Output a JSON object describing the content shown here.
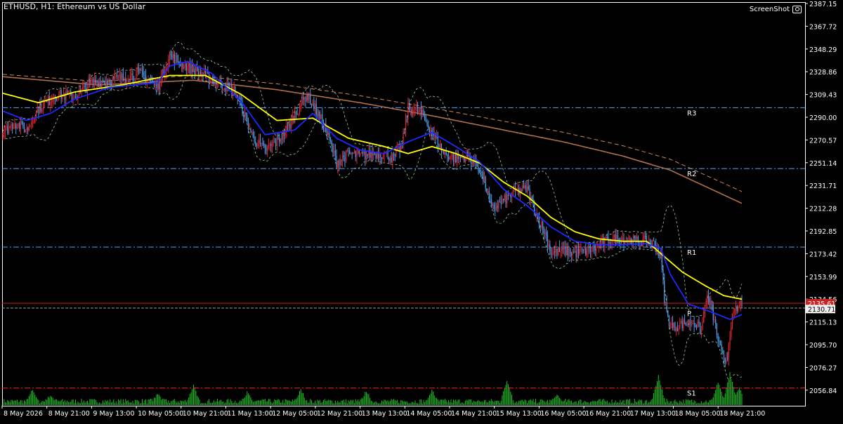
{
  "header": {
    "symbol_line": "ETHUSD, H1:  Ethereum vs US Dollar"
  },
  "watermark": {
    "label": "ScreenShot"
  },
  "colors": {
    "bg": "#000000",
    "bull": "#e0252f",
    "bear": "#4f9be8",
    "yellow_ma": "#ffff00",
    "blue_ma": "#1a2bff",
    "brown_ma": "#b0704a",
    "band": "#9ecf9e",
    "pivot": "#4aa6ff",
    "s1": "#ff2020",
    "volume": "#22c02a",
    "bid": "#cc2222"
  },
  "chart_data": {
    "type": "candlestick",
    "ylim": [
      2049,
      2390
    ],
    "price_ticks": [
      "2387.15",
      "2367.72",
      "2348.29",
      "2328.86",
      "2309.43",
      "2290.00",
      "2270.57",
      "2251.14",
      "2231.71",
      "2212.28",
      "2192.85",
      "2173.42",
      "2153.99",
      "2134.56",
      "2115.13",
      "2095.70",
      "2076.27",
      "2056.84"
    ],
    "time_labels": [
      "8 May 2026",
      "8 May 21:00",
      "9 May 13:00",
      "10 May 05:00",
      "10 May 21:00",
      "11 May 13:00",
      "12 May 05:00",
      "12 May 21:00",
      "13 May 13:00",
      "14 May 05:00",
      "14 May 21:00",
      "15 May 13:00",
      "16 May 05:00",
      "16 May 21:00",
      "17 May 13:00",
      "18 May 05:00",
      "18 May 21:00"
    ],
    "pivot_levels": [
      {
        "name": "R3",
        "value": 2300.8
      },
      {
        "name": "R2",
        "value": 2249.4
      },
      {
        "name": "R1",
        "value": 2183.0
      },
      {
        "name": "P",
        "value": 2131.5
      },
      {
        "name": "S1",
        "value": 2064.0
      }
    ],
    "current_price": {
      "label": "2135.61",
      "value": 2135.61
    },
    "ask_price": {
      "label": "2130.71",
      "value": 2130.71
    },
    "close_series_keypoints": [
      [
        0,
        2280
      ],
      [
        10,
        2288
      ],
      [
        20,
        2282
      ],
      [
        30,
        2300
      ],
      [
        45,
        2312
      ],
      [
        60,
        2310
      ],
      [
        75,
        2322
      ],
      [
        90,
        2324
      ],
      [
        100,
        2326
      ],
      [
        115,
        2330
      ],
      [
        130,
        2318
      ],
      [
        140,
        2345
      ],
      [
        150,
        2338
      ],
      [
        165,
        2330
      ],
      [
        180,
        2322
      ],
      [
        195,
        2315
      ],
      [
        210,
        2275
      ],
      [
        220,
        2265
      ],
      [
        230,
        2272
      ],
      [
        240,
        2285
      ],
      [
        245,
        2295
      ],
      [
        255,
        2312
      ],
      [
        262,
        2300
      ],
      [
        270,
        2285
      ],
      [
        280,
        2255
      ],
      [
        290,
        2262
      ],
      [
        300,
        2260
      ],
      [
        310,
        2262
      ],
      [
        320,
        2262
      ],
      [
        328,
        2258
      ],
      [
        335,
        2270
      ],
      [
        340,
        2300
      ],
      [
        350,
        2298
      ],
      [
        360,
        2280
      ],
      [
        370,
        2262
      ],
      [
        380,
        2258
      ],
      [
        390,
        2260
      ],
      [
        400,
        2250
      ],
      [
        405,
        2235
      ],
      [
        410,
        2215
      ],
      [
        420,
        2222
      ],
      [
        430,
        2230
      ],
      [
        440,
        2232
      ],
      [
        445,
        2218
      ],
      [
        450,
        2205
      ],
      [
        455,
        2195
      ],
      [
        460,
        2178
      ],
      [
        470,
        2180
      ],
      [
        480,
        2178
      ],
      [
        490,
        2180
      ],
      [
        500,
        2183
      ],
      [
        510,
        2190
      ],
      [
        520,
        2190
      ],
      [
        530,
        2188
      ],
      [
        540,
        2188
      ],
      [
        548,
        2185
      ],
      [
        552,
        2175
      ],
      [
        555,
        2140
      ],
      [
        558,
        2122
      ],
      [
        562,
        2115
      ],
      [
        570,
        2118
      ],
      [
        580,
        2120
      ],
      [
        586,
        2112
      ],
      [
        590,
        2140
      ],
      [
        594,
        2135
      ],
      [
        600,
        2105
      ],
      [
        605,
        2085
      ],
      [
        608,
        2092
      ],
      [
        611,
        2120
      ],
      [
        614,
        2128
      ],
      [
        618,
        2133
      ],
      [
        620,
        2136
      ]
    ],
    "ma_yellow_keypoints": [
      [
        0,
        2313
      ],
      [
        30,
        2305
      ],
      [
        60,
        2314
      ],
      [
        100,
        2320
      ],
      [
        140,
        2328
      ],
      [
        170,
        2328
      ],
      [
        200,
        2312
      ],
      [
        230,
        2290
      ],
      [
        260,
        2292
      ],
      [
        290,
        2275
      ],
      [
        320,
        2268
      ],
      [
        340,
        2262
      ],
      [
        360,
        2268
      ],
      [
        380,
        2262
      ],
      [
        400,
        2254
      ],
      [
        420,
        2238
      ],
      [
        440,
        2226
      ],
      [
        460,
        2208
      ],
      [
        480,
        2196
      ],
      [
        500,
        2190
      ],
      [
        520,
        2188
      ],
      [
        540,
        2188
      ],
      [
        555,
        2175
      ],
      [
        570,
        2162
      ],
      [
        590,
        2150
      ],
      [
        605,
        2142
      ],
      [
        620,
        2139
      ]
    ],
    "ma_blue_keypoints": [
      [
        0,
        2298
      ],
      [
        20,
        2290
      ],
      [
        40,
        2296
      ],
      [
        60,
        2308
      ],
      [
        90,
        2318
      ],
      [
        130,
        2322
      ],
      [
        140,
        2336
      ],
      [
        155,
        2340
      ],
      [
        175,
        2330
      ],
      [
        200,
        2306
      ],
      [
        220,
        2278
      ],
      [
        245,
        2282
      ],
      [
        260,
        2296
      ],
      [
        280,
        2275
      ],
      [
        300,
        2265
      ],
      [
        320,
        2262
      ],
      [
        340,
        2272
      ],
      [
        360,
        2280
      ],
      [
        380,
        2268
      ],
      [
        400,
        2255
      ],
      [
        420,
        2232
      ],
      [
        440,
        2218
      ],
      [
        460,
        2200
      ],
      [
        480,
        2188
      ],
      [
        500,
        2185
      ],
      [
        520,
        2185
      ],
      [
        540,
        2186
      ],
      [
        552,
        2182
      ],
      [
        560,
        2160
      ],
      [
        575,
        2135
      ],
      [
        595,
        2128
      ],
      [
        610,
        2122
      ],
      [
        620,
        2126
      ]
    ],
    "ma_brown_keypoints": [
      [
        0,
        2327
      ],
      [
        80,
        2320
      ],
      [
        160,
        2324
      ],
      [
        230,
        2316
      ],
      [
        300,
        2305
      ],
      [
        360,
        2294
      ],
      [
        420,
        2282
      ],
      [
        470,
        2272
      ],
      [
        520,
        2260
      ],
      [
        560,
        2248
      ],
      [
        590,
        2234
      ],
      [
        620,
        2220
      ]
    ],
    "volume_spikes": [
      [
        25,
        20
      ],
      [
        40,
        12
      ],
      [
        130,
        14
      ],
      [
        160,
        26
      ],
      [
        205,
        16
      ],
      [
        250,
        20
      ],
      [
        305,
        18
      ],
      [
        360,
        19
      ],
      [
        423,
        34
      ],
      [
        465,
        12
      ],
      [
        550,
        40
      ],
      [
        600,
        30
      ],
      [
        610,
        44
      ],
      [
        618,
        24
      ]
    ]
  }
}
